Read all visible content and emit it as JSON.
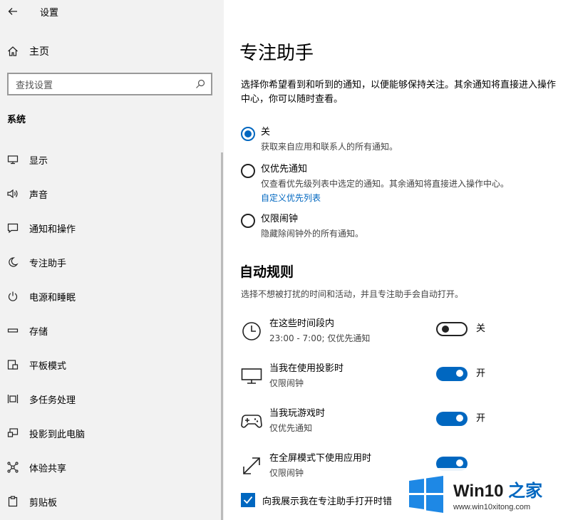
{
  "window": {
    "title": "设置"
  },
  "sidebar": {
    "home_label": "主页",
    "search_placeholder": "查找设置",
    "section_title": "系统",
    "items": [
      {
        "label": "显示",
        "icon": "monitor-icon"
      },
      {
        "label": "声音",
        "icon": "speaker-icon"
      },
      {
        "label": "通知和操作",
        "icon": "notification-icon"
      },
      {
        "label": "专注助手",
        "icon": "moon-icon"
      },
      {
        "label": "电源和睡眠",
        "icon": "power-icon"
      },
      {
        "label": "存储",
        "icon": "storage-icon"
      },
      {
        "label": "平板模式",
        "icon": "tablet-icon"
      },
      {
        "label": "多任务处理",
        "icon": "multitask-icon"
      },
      {
        "label": "投影到此电脑",
        "icon": "project-icon"
      },
      {
        "label": "体验共享",
        "icon": "share-icon"
      },
      {
        "label": "剪贴板",
        "icon": "clipboard-icon"
      }
    ]
  },
  "main": {
    "title": "专注助手",
    "description": "选择你希望看到和听到的通知，以便能够保持关注。其余通知将直接进入操作中心，你可以随时查看。",
    "options": [
      {
        "label": "关",
        "sub": "获取来自应用和联系人的所有通知。",
        "checked": true
      },
      {
        "label": "仅优先通知",
        "sub": "仅查看优先级列表中选定的通知。其余通知将直接进入操作中心。",
        "link": "自定义优先列表",
        "checked": false
      },
      {
        "label": "仅限闹钟",
        "sub": "隐藏除闹钟外的所有通知。",
        "checked": false
      }
    ],
    "auto_rules": {
      "heading": "自动规则",
      "description": "选择不想被打扰的时间和活动，并且专注助手会自动打开。",
      "rules": [
        {
          "title": "在这些时间段内",
          "sub": "23:00 - 7:00; 仅优先通知",
          "state": "关",
          "on": false,
          "icon": "clock-icon"
        },
        {
          "title": "当我在使用投影时",
          "sub": "仅限闹钟",
          "state": "开",
          "on": true,
          "icon": "display-icon"
        },
        {
          "title": "当我玩游戏时",
          "sub": "仅优先通知",
          "state": "开",
          "on": true,
          "icon": "gamepad-icon"
        },
        {
          "title": "在全屏模式下使用应用时",
          "sub": "仅限闹钟",
          "state": "",
          "on": true,
          "icon": "fullscreen-icon"
        }
      ]
    },
    "checkbox_label": "向我展示我在专注助手打开时错",
    "checkbox_checked": true
  },
  "watermark": {
    "brand_main": "Win10",
    "brand_accent": " 之家",
    "url": "www.win10xitong.com"
  },
  "colors": {
    "accent": "#0067c0",
    "sidebar_bg": "#f2f2f2"
  }
}
